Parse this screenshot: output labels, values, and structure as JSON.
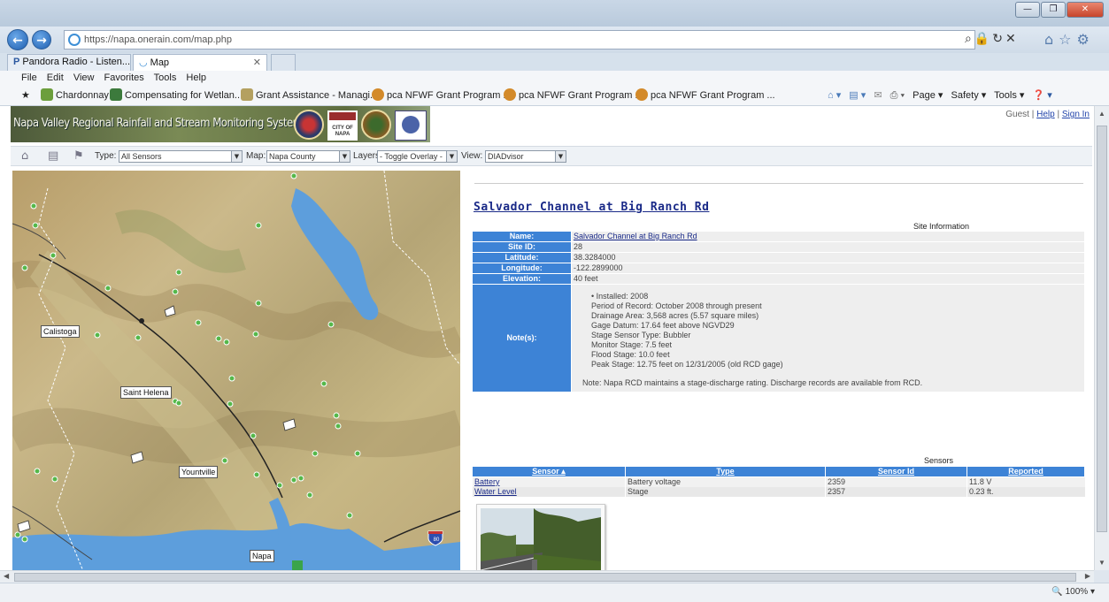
{
  "browser": {
    "url": "https://napa.onerain.com/map.php",
    "tabs": [
      {
        "label": "Pandora Radio - Listen..."
      },
      {
        "label": "Map"
      }
    ],
    "menu": [
      "File",
      "Edit",
      "View",
      "Favorites",
      "Tools",
      "Help"
    ],
    "favorites": [
      "Chardonnay",
      "Compensating for Wetlan...",
      "Grant Assistance - Managi...",
      "pca NFWF Grant Program ...",
      "pca NFWF Grant Program ...",
      "pca NFWF Grant Program ..."
    ],
    "command_bar": [
      "Page ▾",
      "Safety ▾",
      "Tools ▾"
    ],
    "zoom": "100%"
  },
  "header": {
    "title": "Napa Valley Regional Rainfall and Stream Monitoring System",
    "seal_text": "CITY OF NAPA",
    "user": "Guest",
    "help": "Help",
    "sign_in": "Sign In"
  },
  "toolbar": {
    "type_label": "Type:",
    "type_value": "All Sensors",
    "map_label": "Map:",
    "map_value": "Napa County",
    "layers_label": "Layers:",
    "layers_value": "- Toggle Overlay -",
    "view_label": "View:",
    "view_value": "DIADvisor"
  },
  "map": {
    "labels": [
      "Calistoga",
      "Saint Helena",
      "Yountville",
      "Napa"
    ],
    "shield": "80"
  },
  "site": {
    "title": "Salvador Channel at Big Ranch Rd",
    "info_caption": "Site Information",
    "fields": {
      "name_label": "Name:",
      "name": "Salvador Channel at Big Ranch Rd",
      "site_id_label": "Site ID:",
      "site_id": "28",
      "latitude_label": "Latitude:",
      "latitude": "38.3284000",
      "longitude_label": "Longitude:",
      "longitude": "-122.2899000",
      "elevation_label": "Elevation:",
      "elevation": "40 feet",
      "notes_label": "Note(s):"
    },
    "notes": [
      "Installed: 2008",
      "Period of Record: October 2008 through present",
      "Drainage Area: 3,568 acres (5.57 square miles)",
      "Gage Datum: 17.64 feet above NGVD29",
      "Stage Sensor Type: Bubbler",
      "Monitor Stage: 7.5 feet",
      "Flood Stage: 10.0 feet",
      "Peak Stage: 12.75 feet on 12/31/2005 (old RCD gage)"
    ],
    "note_footer": "Note: Napa RCD maintains a stage-discharge rating. Discharge records are available from RCD.",
    "sensors_caption": "Sensors",
    "sensor_headers": [
      "Sensor",
      "Type",
      "Sensor Id",
      "Reported"
    ],
    "sensors": [
      {
        "sensor": "Battery",
        "type": "Battery voltage",
        "id": "2359",
        "reported": "11.8 V"
      },
      {
        "sensor": "Water Level",
        "type": "Stage",
        "id": "2357",
        "reported": "0.23 ft."
      }
    ]
  }
}
